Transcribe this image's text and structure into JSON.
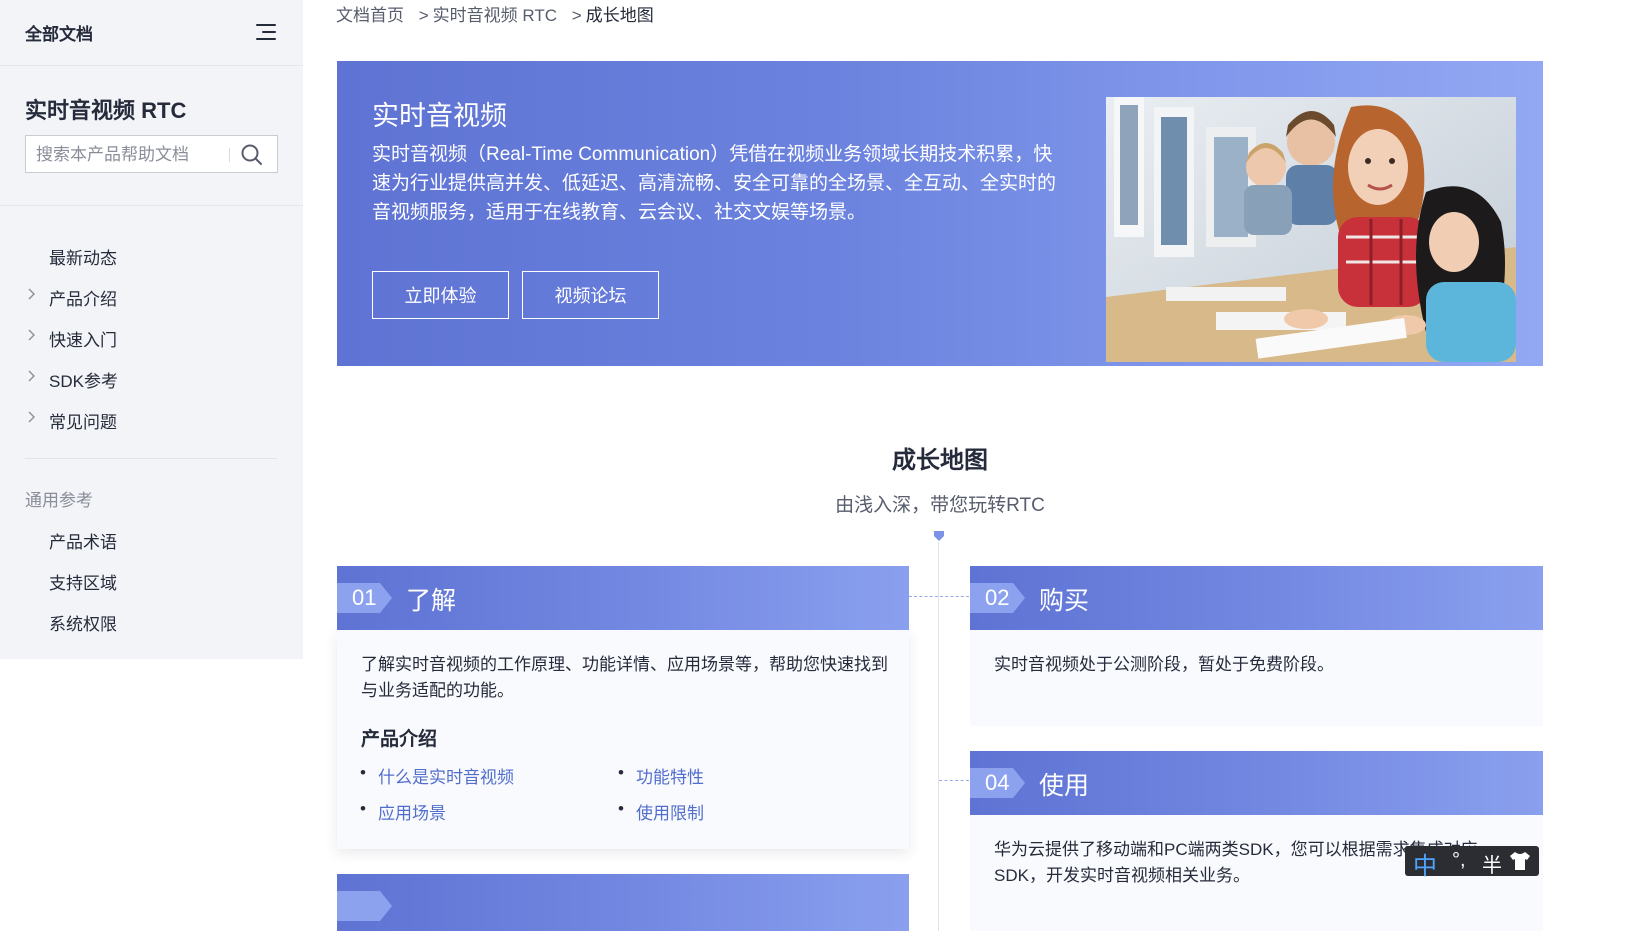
{
  "sidebar": {
    "all_docs": "全部文档",
    "product_title": "实时音视频 RTC",
    "search_placeholder": "搜索本产品帮助文档",
    "nav": [
      {
        "label": "最新动态",
        "expandable": false
      },
      {
        "label": "产品介绍",
        "expandable": true
      },
      {
        "label": "快速入门",
        "expandable": true
      },
      {
        "label": "SDK参考",
        "expandable": true
      },
      {
        "label": "常见问题",
        "expandable": true
      }
    ],
    "reference_title": "通用参考",
    "reference_items": [
      "产品术语",
      "支持区域",
      "系统权限"
    ]
  },
  "breadcrumb": [
    "文档首页",
    "实时音视频 RTC",
    "成长地图"
  ],
  "breadcrumb_separator": ">",
  "banner": {
    "title": "实时音视频",
    "description": "实时音视频（Real-Time Communication）凭借在视频业务领域长期技术积累，快速为行业提供高并发、低延迟、高清流畅、安全可靠的全场景、全互动、全实时的音视频服务，适用于在线教育、云会议、社交文娱等场景。",
    "btn_try": "立即体验",
    "btn_forum": "视频论坛"
  },
  "growth_map": {
    "title": "成长地图",
    "subtitle": "由浅入深，带您玩转RTC",
    "steps": [
      {
        "num": "01",
        "title": "了解",
        "desc": "了解实时音视频的工作原理、功能详情、应用场景等，帮助您快速找到与业务适配的功能。",
        "section_title": "产品介绍",
        "links": [
          "什么是实时音视频",
          "功能特性",
          "应用场景",
          "使用限制"
        ]
      },
      {
        "num": "02",
        "title": "购买",
        "desc": "实时音视频处于公测阶段，暂处于免费阶段。"
      },
      {
        "num": "04",
        "title": "使用",
        "desc": "华为云提供了移动端和PC端两类SDK，您可以根据需求集成对应SDK，开发实时音视频相关业务。"
      }
    ]
  },
  "ime_toolbar": {
    "mode": "中",
    "punct": "°,",
    "width": "半",
    "skin_icon": "shirt-icon"
  },
  "colors": {
    "accent": "#5e73d3",
    "link": "#526ecc",
    "sidebar_bg": "#f2f4f8",
    "text": "#252b3a"
  }
}
